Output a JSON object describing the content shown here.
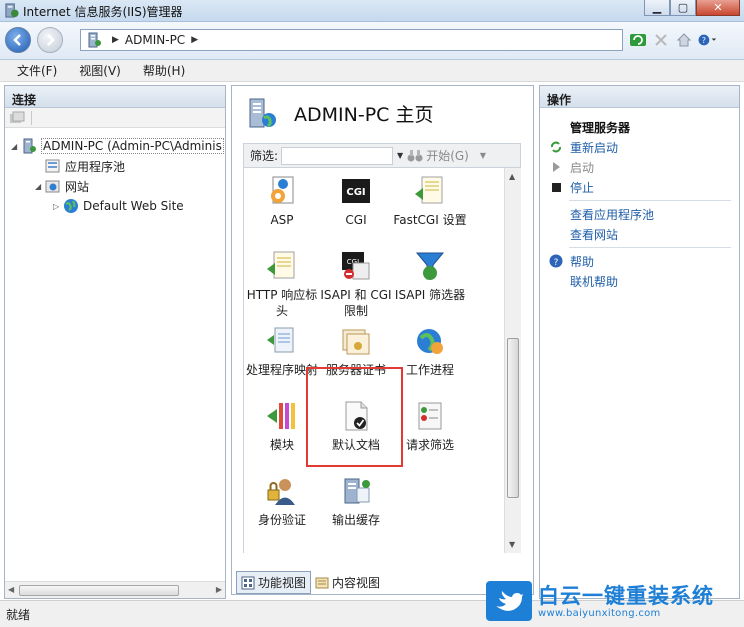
{
  "window": {
    "title": "Internet 信息服务(IIS)管理器"
  },
  "address": {
    "segment": "ADMIN-PC"
  },
  "menu": [
    "文件(F)",
    "视图(V)",
    "帮助(H)"
  ],
  "connections": {
    "header": "连接",
    "tree": [
      {
        "label": "ADMIN-PC (Admin-PC\\Adminis",
        "depth": 0,
        "icon": "server-icon"
      },
      {
        "label": "应用程序池",
        "depth": 1,
        "icon": "app-pool-icon"
      },
      {
        "label": "网站",
        "depth": 1,
        "icon": "sites-folder-icon"
      },
      {
        "label": "Default Web Site",
        "depth": 2,
        "icon": "globe-icon"
      }
    ]
  },
  "center": {
    "title": "ADMIN-PC 主页",
    "filter_label": "筛选:",
    "start_label": "开始(G)",
    "items": [
      {
        "label": "ASP",
        "icon": "asp-icon"
      },
      {
        "label": "CGI",
        "icon": "cgi-icon"
      },
      {
        "label": "FastCGI 设置",
        "icon": "fastcgi-icon"
      },
      {
        "label": "HTTP 响应标头",
        "icon": "http-headers-icon"
      },
      {
        "label": "ISAPI 和 CGI 限制",
        "icon": "isapi-cgi-icon"
      },
      {
        "label": "ISAPI 筛选器",
        "icon": "isapi-filter-icon"
      },
      {
        "label": "处理程序映射",
        "icon": "handler-mapping-icon"
      },
      {
        "label": "服务器证书",
        "icon": "certificate-icon"
      },
      {
        "label": "工作进程",
        "icon": "worker-process-icon"
      },
      {
        "label": "模块",
        "icon": "modules-icon"
      },
      {
        "label": "默认文档",
        "icon": "default-document-icon"
      },
      {
        "label": "请求筛选",
        "icon": "request-filter-icon"
      },
      {
        "label": "身份验证",
        "icon": "authentication-icon"
      },
      {
        "label": "输出缓存",
        "icon": "output-cache-icon"
      }
    ],
    "tabs": {
      "features": "功能视图",
      "content": "内容视图"
    }
  },
  "actions": {
    "header": "操作",
    "group1": "管理服务器",
    "restart": "重新启动",
    "start": "启动",
    "stop": "停止",
    "view_pools": "查看应用程序池",
    "view_sites": "查看网站",
    "help": "帮助",
    "online_help": "联机帮助"
  },
  "status": "就绪",
  "watermark": {
    "title": "白云一键重装系统",
    "url": "www.baiyunxitong.com"
  },
  "colors": {
    "link": "#1f5ea8",
    "highlight": "#e23a32",
    "watermark": "#1d7fd6"
  }
}
